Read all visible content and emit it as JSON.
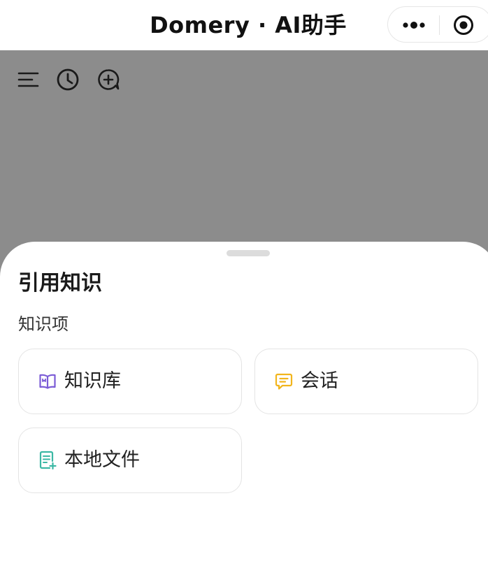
{
  "app": {
    "title": "Domery · AI助手"
  },
  "capsule": {
    "more_icon": "more-dots-icon",
    "close_icon": "target-close-icon"
  },
  "toolbar": {
    "items": [
      {
        "icon": "menu-icon"
      },
      {
        "icon": "history-clock-icon"
      },
      {
        "icon": "new-chat-icon"
      }
    ]
  },
  "sheet": {
    "title": "引用知识",
    "section_label": "知识项",
    "options": [
      {
        "label": "知识库",
        "icon": "book-icon",
        "color": "#7b5cd6"
      },
      {
        "label": "会话",
        "icon": "chat-bubble-icon",
        "color": "#f2b51c"
      },
      {
        "label": "本地文件",
        "icon": "file-add-icon",
        "color": "#3bb8a4"
      }
    ]
  },
  "colors": {
    "overlay": "#8c8c8c",
    "sheet_background": "#ffffff",
    "text_primary": "#1a1a1a"
  }
}
